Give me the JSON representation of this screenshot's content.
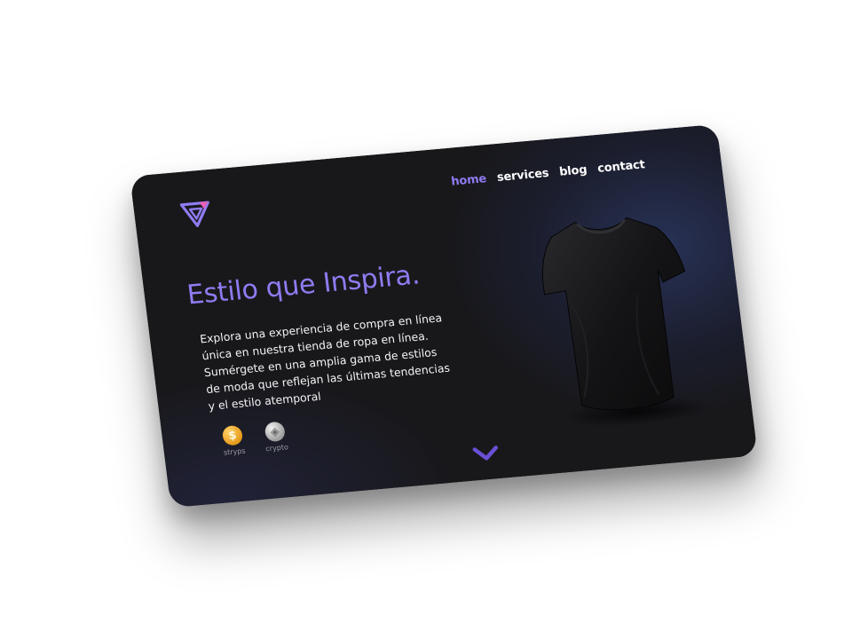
{
  "nav": {
    "items": [
      {
        "label": "home",
        "active": true
      },
      {
        "label": "services",
        "active": false
      },
      {
        "label": "blog",
        "active": false
      },
      {
        "label": "contact",
        "active": false
      }
    ]
  },
  "hero": {
    "title": "Estilo que Inspira.",
    "description": "Explora una experiencia de compra en línea única en nuestra tienda de ropa en línea. Sumérgete en una amplia gama de estilos de moda que reflejan las últimas tendencias y el estilo atemporal"
  },
  "payments": [
    {
      "label": "stryps",
      "icon": "dollar-coin-icon",
      "glyph": "$"
    },
    {
      "label": "crypto",
      "icon": "crypto-coin-icon",
      "glyph": "◈"
    }
  ],
  "colors": {
    "accent": "#8f7cf2",
    "logo_pink": "#e85fb5",
    "background": "#18181b",
    "glow": "#283257"
  }
}
